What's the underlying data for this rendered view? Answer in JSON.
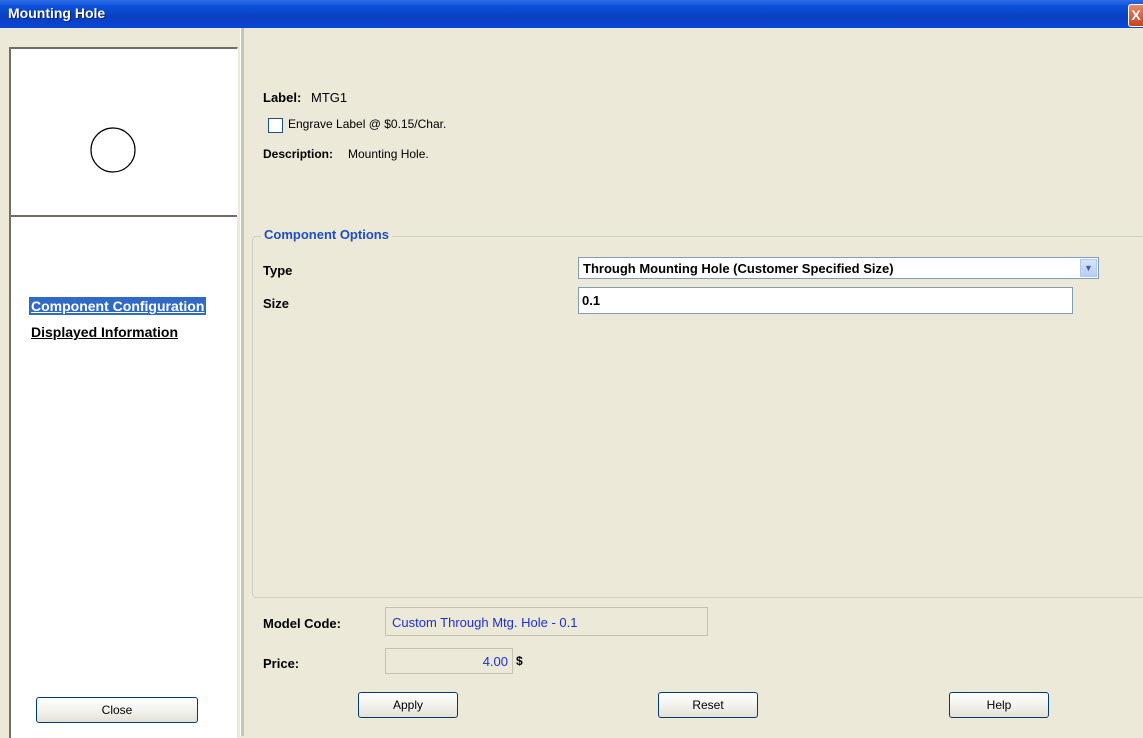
{
  "window": {
    "title": "Mounting Hole",
    "close_glyph": "X"
  },
  "nav": {
    "items": [
      {
        "label": "Component Configuration",
        "active": true
      },
      {
        "label": "Displayed Information",
        "active": false
      }
    ],
    "close_button": "Close"
  },
  "preview": {
    "icon": "circle-outline-icon"
  },
  "info": {
    "label_caption": "Label:",
    "label_value": "MTG1",
    "engrave_label": "Engrave Label @ $0.15/Char.",
    "engrave_checked": false,
    "description_caption": "Description:",
    "description_value": "Mounting Hole."
  },
  "options": {
    "group_title": "Component Options",
    "type_label": "Type",
    "type_value": "Through Mounting Hole (Customer Specified Size)",
    "size_label": "Size",
    "size_value": "0.1"
  },
  "summary": {
    "model_code_label": "Model Code:",
    "model_code_value": "Custom Through Mtg. Hole - 0.1",
    "price_label": "Price:",
    "price_value": "4.00",
    "price_currency": "$"
  },
  "buttons": {
    "apply": "Apply",
    "reset": "Reset",
    "help": "Help"
  },
  "colors": {
    "title_bar": "#0a46d6",
    "nav_active_bg": "#316ac5",
    "group_title": "#1c4fc0",
    "field_text": "#1c2fd0"
  }
}
